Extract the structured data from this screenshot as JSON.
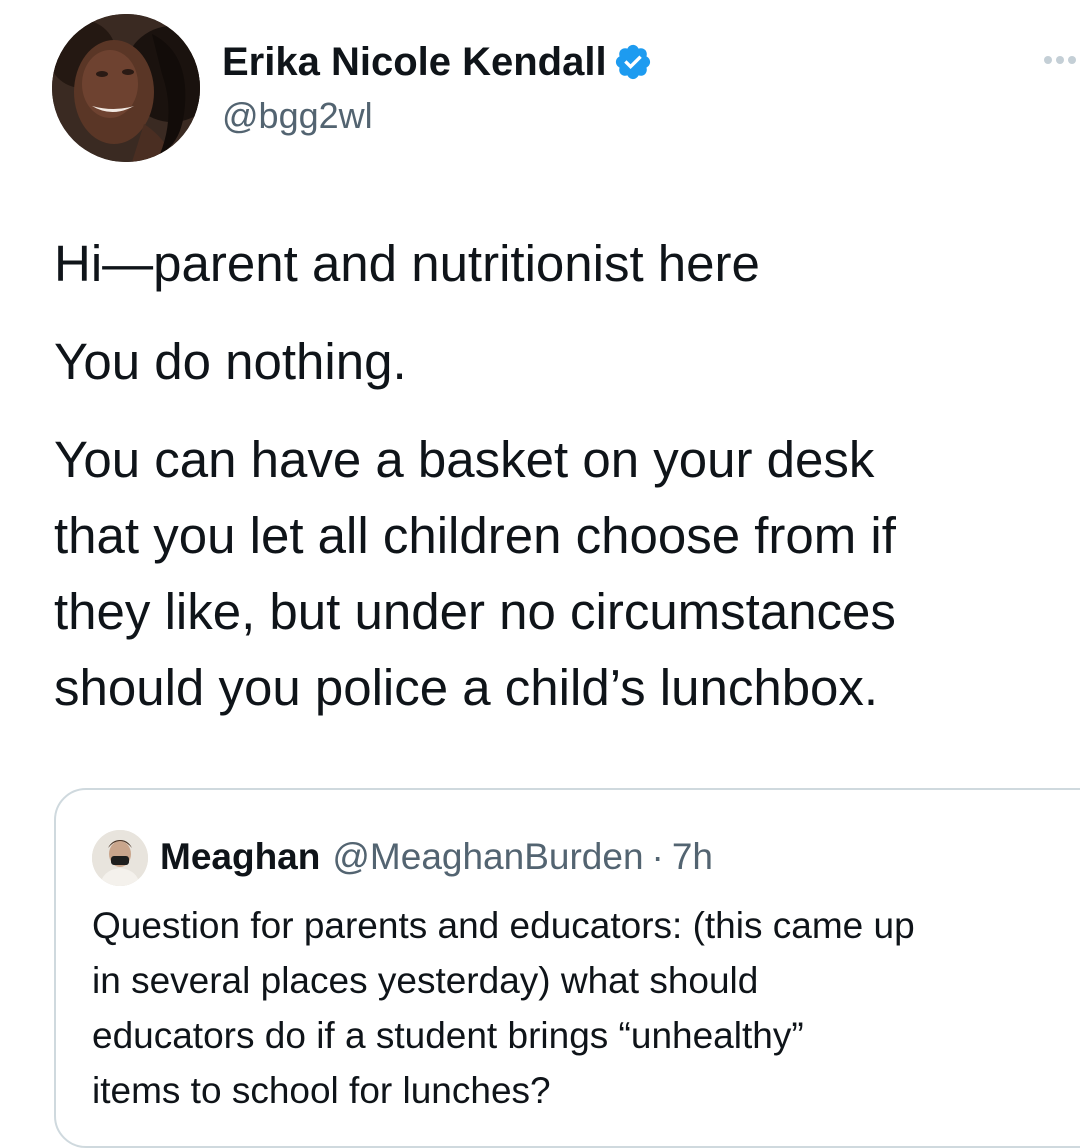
{
  "author": {
    "display_name": "Erika Nicole Kendall",
    "handle": "@bgg2wl",
    "verified_icon": "verified-badge-icon",
    "avatar": "profile-photo"
  },
  "more_icon": "more-horizontal-icon",
  "tweet": {
    "paragraph_1": "Hi—parent and nutritionist here",
    "paragraph_2": "You do nothing.",
    "paragraph_3": "You can have a basket on your desk\nthat you let all children choose from if\nthey like, but under no circumstances\nshould you police a child’s lunchbox."
  },
  "quoted_tweet": {
    "display_name": "Meaghan",
    "handle": "@MeaghanBurden",
    "separator": "·",
    "time": "7h",
    "text": "Question for parents and educators: (this came up\nin several places yesterday) what should\neducators do if a student brings “unhealthy”\nitems to school for lunches?"
  },
  "colors": {
    "text_primary": "#0f1419",
    "text_secondary": "#536471",
    "verified_blue": "#1d9bf0",
    "border": "#cfd9de"
  }
}
